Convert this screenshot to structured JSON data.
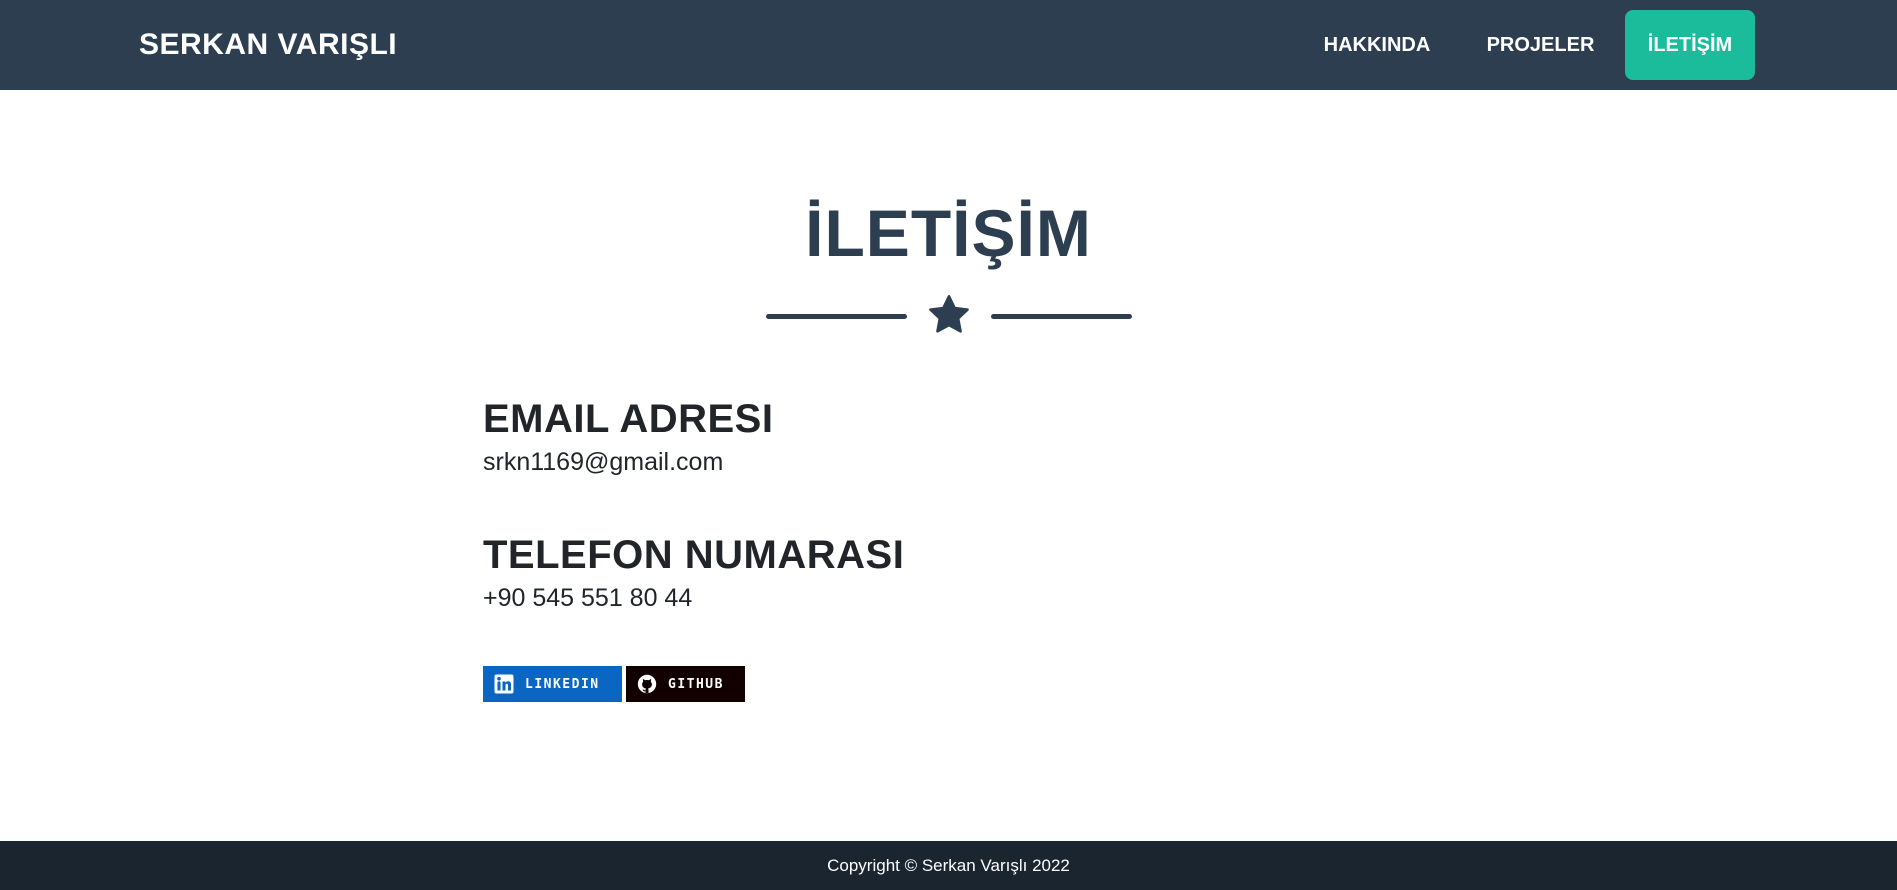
{
  "nav": {
    "brand": "SERKAN VARIŞLI",
    "items": [
      {
        "label": "HAKKINDA"
      },
      {
        "label": "PROJELER"
      },
      {
        "label": "İLETİŞİM"
      }
    ]
  },
  "contact": {
    "title": "İLETİŞİM",
    "divider_icon": "star-icon",
    "email_heading": "EMAIL ADRESI",
    "email": "srkn1169@gmail.com",
    "phone_heading": "TELEFON NUMARASI",
    "phone": "+90 545 551 80 44",
    "badges": [
      {
        "label": "LINKEDIN",
        "icon": "linkedin-icon",
        "color": "#0a66c2"
      },
      {
        "label": "GITHUB",
        "icon": "github-icon",
        "color": "#120000"
      }
    ]
  },
  "footer": {
    "copyright": "Copyright © Serkan Varışlı 2022"
  },
  "colors": {
    "navbar": "#2c3e50",
    "accent": "#1abc9c",
    "footer": "#1a252f",
    "heading": "#2c3e50"
  }
}
